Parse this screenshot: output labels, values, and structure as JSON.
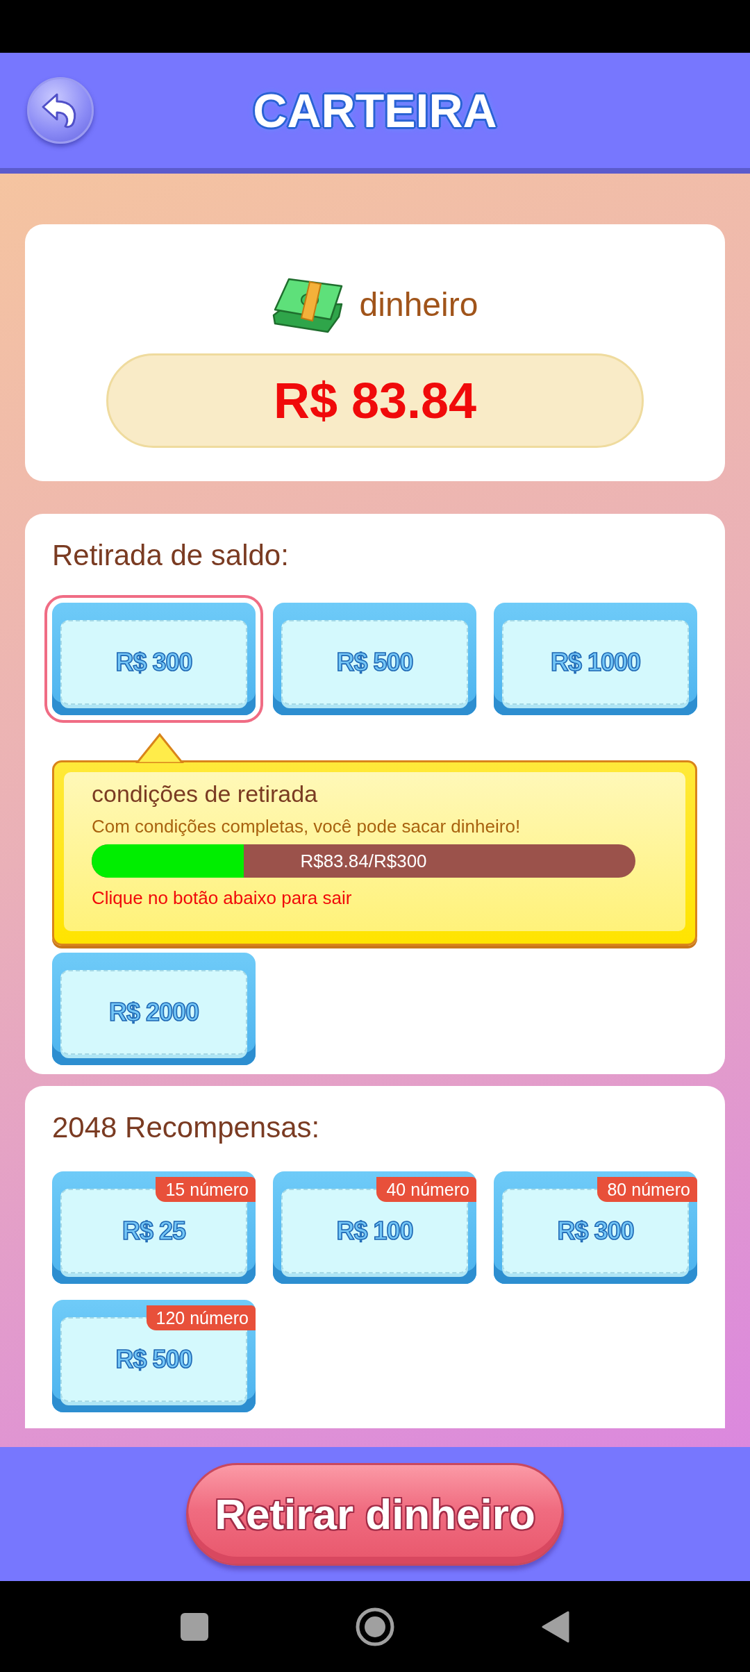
{
  "header": {
    "title": "CARTEIRA"
  },
  "balance": {
    "label": "dinheiro",
    "amount": "R$ 83.84"
  },
  "withdrawal": {
    "heading": "Retirada de saldo:",
    "options": [
      {
        "label": "R$ 300",
        "selected": true
      },
      {
        "label": "R$ 500",
        "selected": false
      },
      {
        "label": "R$ 1000",
        "selected": false
      },
      {
        "label": "R$ 2000",
        "selected": false
      }
    ],
    "conditions": {
      "title": "condições de retirada",
      "message": "Com condições completas, você pode sacar dinheiro!",
      "progress": {
        "level": 0.28,
        "reading": "R$83.84/R$300"
      },
      "hint": "Clique no botão abaixo para sair"
    }
  },
  "rewards": {
    "heading": "2048 Recompensas:",
    "options": [
      {
        "label": "R$ 25",
        "badge": "15 número"
      },
      {
        "label": "R$ 100",
        "badge": "40 número"
      },
      {
        "label": "R$ 300",
        "badge": "80 número"
      },
      {
        "label": "R$ 500",
        "badge": "120 número"
      }
    ]
  },
  "action_button": "Retirar dinheiro"
}
